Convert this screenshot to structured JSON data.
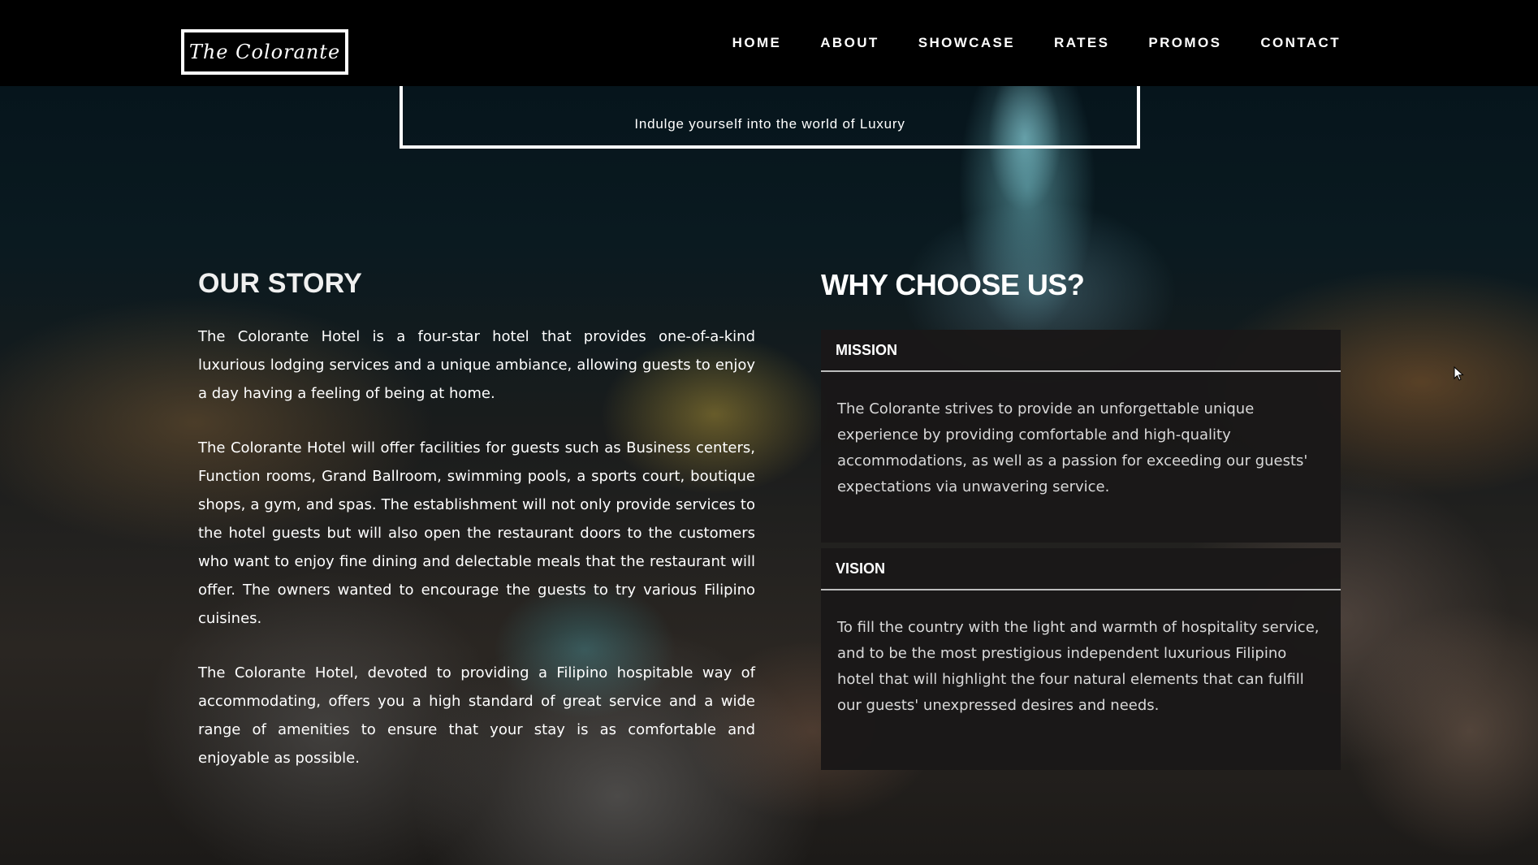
{
  "nav": {
    "logo": "The Colorante",
    "items": [
      "HOME",
      "ABOUT",
      "SHOWCASE",
      "RATES",
      "PROMOS",
      "CONTACT"
    ]
  },
  "hero": {
    "subtitle": "Indulge yourself into the world of Luxury"
  },
  "story": {
    "title": "OUR STORY",
    "paragraphs": [
      "The Colorante Hotel is a four-star hotel that provides one-of-a-kind luxurious lodging services and a unique ambiance, allowing guests to enjoy a day having a feeling of being at home.",
      "The Colorante Hotel will offer facilities for guests such as Business centers, Function rooms, Grand Ballroom, swimming pools, a sports court, boutique shops, a gym, and spas. The establishment will not only provide services to the hotel guests but will also open the restaurant doors to the customers who want to enjoy fine dining and delectable meals that the restaurant will offer. The owners wanted to encourage the guests to try various Filipino cuisines.",
      "The Colorante Hotel, devoted to providing a Filipino hospitable way of accommodating, offers you a high standard of great service and a wide range of amenities to ensure that your stay is as comfortable and enjoyable as possible."
    ]
  },
  "why": {
    "title": "WHY CHOOSE US?",
    "mission": {
      "heading": "MISSION",
      "text": "The Colorante strives to provide an unforgettable unique experience by providing comfortable and high-quality accommodations, as well as a passion for exceeding our guests' expectations via unwavering service."
    },
    "vision": {
      "heading": "VISION",
      "text": "To fill the country with the light and warmth of hospitality service, and to be the most prestigious independent luxurious Filipino hotel that will highlight the four natural elements that can fulfill our guests' unexpressed desires and needs."
    }
  },
  "icons": {
    "cursor": "mouse-pointer-icon"
  },
  "colors": {
    "topbar": "#000000",
    "card_bg": "#1a1818",
    "text": "#ffffff"
  }
}
